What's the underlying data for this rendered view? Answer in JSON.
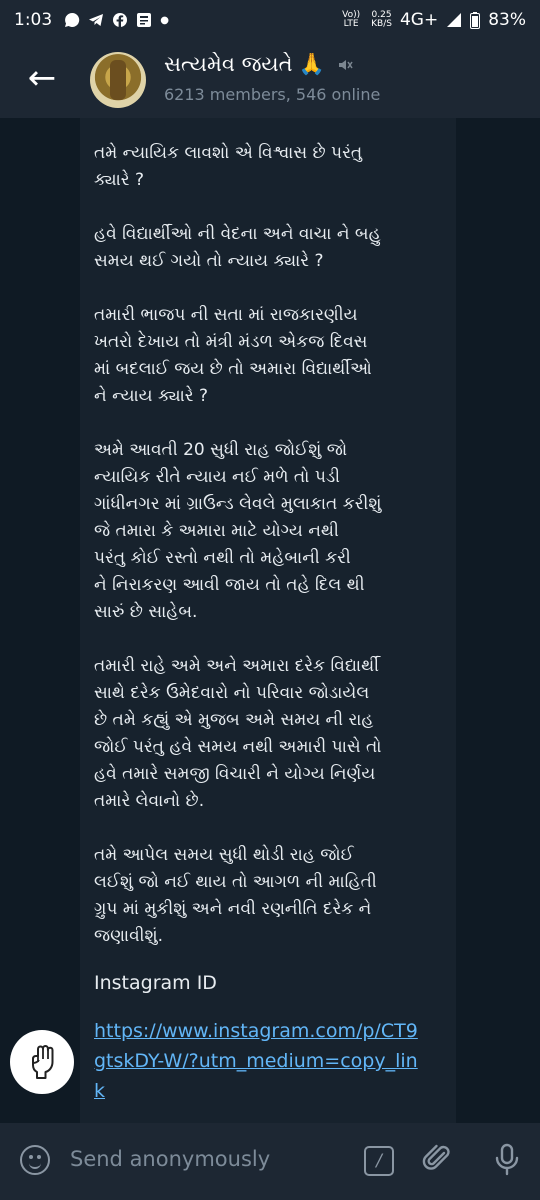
{
  "status_bar": {
    "time": "1:03",
    "net_speed": "0.25",
    "net_unit": "KB/S",
    "volte": "Vo)) LTE",
    "network": "4G+",
    "battery": "83%"
  },
  "header": {
    "back_label": "←",
    "title": "સત્યમેવ જયતે",
    "title_emoji": "🙏",
    "subtitle": "6213 members, 546 online"
  },
  "message": {
    "text": "તમે ન્યાયિક લાવશો એ વિશ્વાસ છે પરંતુ\nક્યારે ?\n\nહવે વિદ્યાર્થીઓ ની વેદના અને વાચા ને બહુ\nસમય થઈ ગયો તો ન્યાય ક્યારે ?\n\nતમારી ભાજપ ની સતા માં રાજકારણીય\nખતરો દેખાય તો મંત્રી મંડળ એકજ દિવસ\nમાં બદલાઈ જય છે તો અમારા વિદ્યાર્થીઓ\nને ન્યાય ક્યારે ?\n\nઅમે આવતી 20 સુધી રાહ જોઈશું જો\nન્યાયિક રીતે ન્યાય નઈ મળે તો પડી\nગાંધીનગર માં ગ્રાઉન્ડ લેવલે મુલાકાત કરીશું\nજે તમારા કે અમારા માટે યોગ્ય નથી\nપરંતુ કોઈ રસ્તો નથી તો મહેબાની કરી\nને નિરાકરણ આવી જાય તો તહે દિલ થી\nસારું છે સાહેબ.\n\nતમારી રાહે અમે અને અમારા દરેક વિદ્યાર્થી\nસાથે દરેક ઉમેદવારો નો પરિવાર જોડાયેલ\nછે તમે કહ્યું એ મુજબ અમે સમય ની રાહ\nજોઈ પરંતુ હવે સમય નથી અમારી પાસે તો\nહવે તમારે સમજી વિચારી ને યોગ્ય નિર્ણય\nતમારે લેવાનો છે.\n\nતમે આપેલ સમય સુધી થોડી રાહ જોઈ\nલઈશું જો નઈ થાય તો આગળ ની માહિતી\nગ્રુપ માં મુકીશું અને નવી રણનીતિ દરેક ને\nજણાવીશું.",
    "instagram_label": "Instagram ID",
    "link": "https://www.instagram.com/p/CT9gtskDY-W/?utm_medium=copy_link"
  },
  "input": {
    "placeholder": "Send anonymously",
    "command_glyph": "/"
  },
  "colors": {
    "bar": "#1d2733",
    "background": "#0f1a24",
    "bubble": "#17222d",
    "link": "#62b6f7",
    "secondary_text": "#7d8b99"
  }
}
